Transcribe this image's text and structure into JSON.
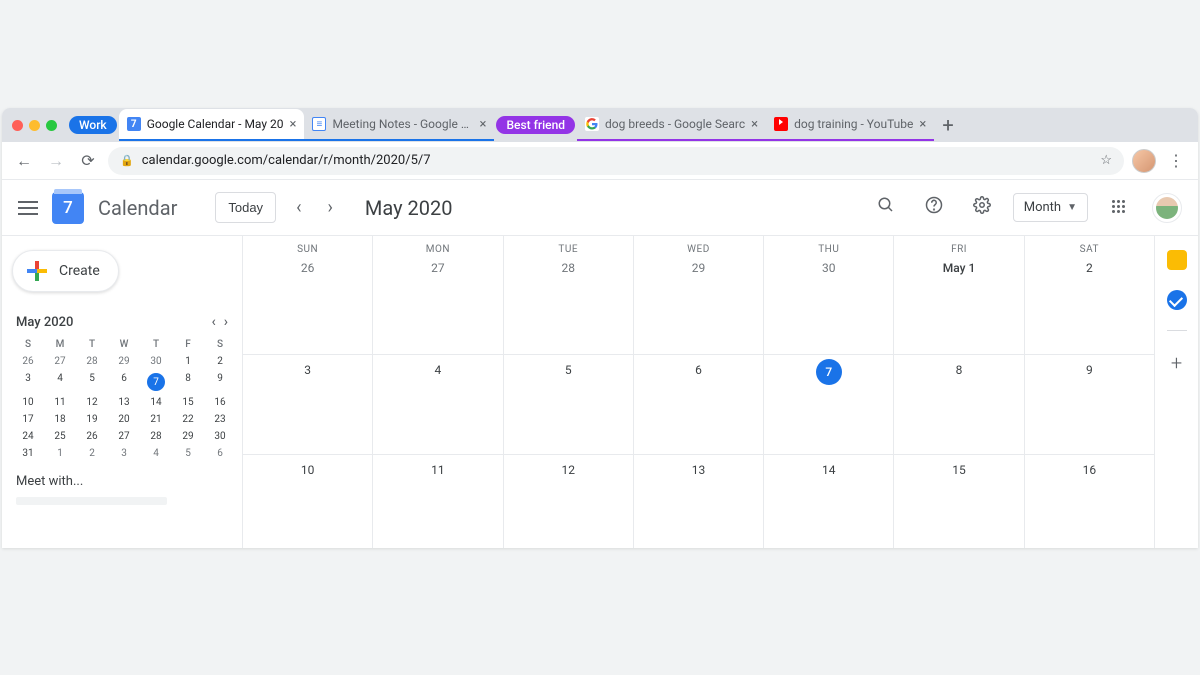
{
  "browser": {
    "url": "calendar.google.com/calendar/r/month/2020/5/7",
    "tab_groups": [
      {
        "label": "Work",
        "color": "#1a73e8"
      },
      {
        "label": "Best friend",
        "color": "#9334e6"
      }
    ],
    "tabs": [
      {
        "title": "Google Calendar - May 20",
        "favicon": "7",
        "group": 0,
        "active": true
      },
      {
        "title": "Meeting Notes - Google Do",
        "group": 0
      },
      {
        "title": "dog breeds - Google Searc",
        "group": 1
      },
      {
        "title": "dog training - YouTube",
        "group": 1
      }
    ]
  },
  "header": {
    "app_name": "Calendar",
    "logo_day": "7",
    "today_label": "Today",
    "period": "May 2020",
    "view": "Month"
  },
  "sidebar": {
    "create_label": "Create",
    "meet_with": "Meet with...",
    "mini": {
      "month": "May 2020",
      "dow": [
        "S",
        "M",
        "T",
        "W",
        "T",
        "F",
        "S"
      ],
      "today": 7,
      "weeks": [
        [
          {
            "n": 26,
            "out": true
          },
          {
            "n": 27,
            "out": true
          },
          {
            "n": 28,
            "out": true
          },
          {
            "n": 29,
            "out": true
          },
          {
            "n": 30,
            "out": true
          },
          {
            "n": 1
          },
          {
            "n": 2
          }
        ],
        [
          {
            "n": 3
          },
          {
            "n": 4
          },
          {
            "n": 5
          },
          {
            "n": 6
          },
          {
            "n": 7,
            "today": true
          },
          {
            "n": 8
          },
          {
            "n": 9
          }
        ],
        [
          {
            "n": 10
          },
          {
            "n": 11
          },
          {
            "n": 12
          },
          {
            "n": 13
          },
          {
            "n": 14
          },
          {
            "n": 15
          },
          {
            "n": 16
          }
        ],
        [
          {
            "n": 17
          },
          {
            "n": 18
          },
          {
            "n": 19
          },
          {
            "n": 20
          },
          {
            "n": 21
          },
          {
            "n": 22
          },
          {
            "n": 23
          }
        ],
        [
          {
            "n": 24
          },
          {
            "n": 25
          },
          {
            "n": 26
          },
          {
            "n": 27
          },
          {
            "n": 28
          },
          {
            "n": 29
          },
          {
            "n": 30
          }
        ],
        [
          {
            "n": 31
          },
          {
            "n": 1,
            "out": true
          },
          {
            "n": 2,
            "out": true
          },
          {
            "n": 3,
            "out": true
          },
          {
            "n": 4,
            "out": true
          },
          {
            "n": 5,
            "out": true
          },
          {
            "n": 6,
            "out": true
          }
        ]
      ]
    }
  },
  "grid": {
    "dow": [
      "SUN",
      "MON",
      "TUE",
      "WED",
      "THU",
      "FRI",
      "SAT"
    ],
    "today": 7,
    "rows": [
      [
        {
          "label": "26",
          "out": true
        },
        {
          "label": "27",
          "out": true
        },
        {
          "label": "28",
          "out": true
        },
        {
          "label": "29",
          "out": true
        },
        {
          "label": "30",
          "out": true
        },
        {
          "label": "May 1",
          "first": true
        },
        {
          "label": "2"
        }
      ],
      [
        {
          "label": "3"
        },
        {
          "label": "4"
        },
        {
          "label": "5"
        },
        {
          "label": "6"
        },
        {
          "label": "7",
          "today": true
        },
        {
          "label": "8"
        },
        {
          "label": "9"
        }
      ],
      [
        {
          "label": "10"
        },
        {
          "label": "11"
        },
        {
          "label": "12"
        },
        {
          "label": "13"
        },
        {
          "label": "14"
        },
        {
          "label": "15"
        },
        {
          "label": "16"
        }
      ]
    ]
  }
}
